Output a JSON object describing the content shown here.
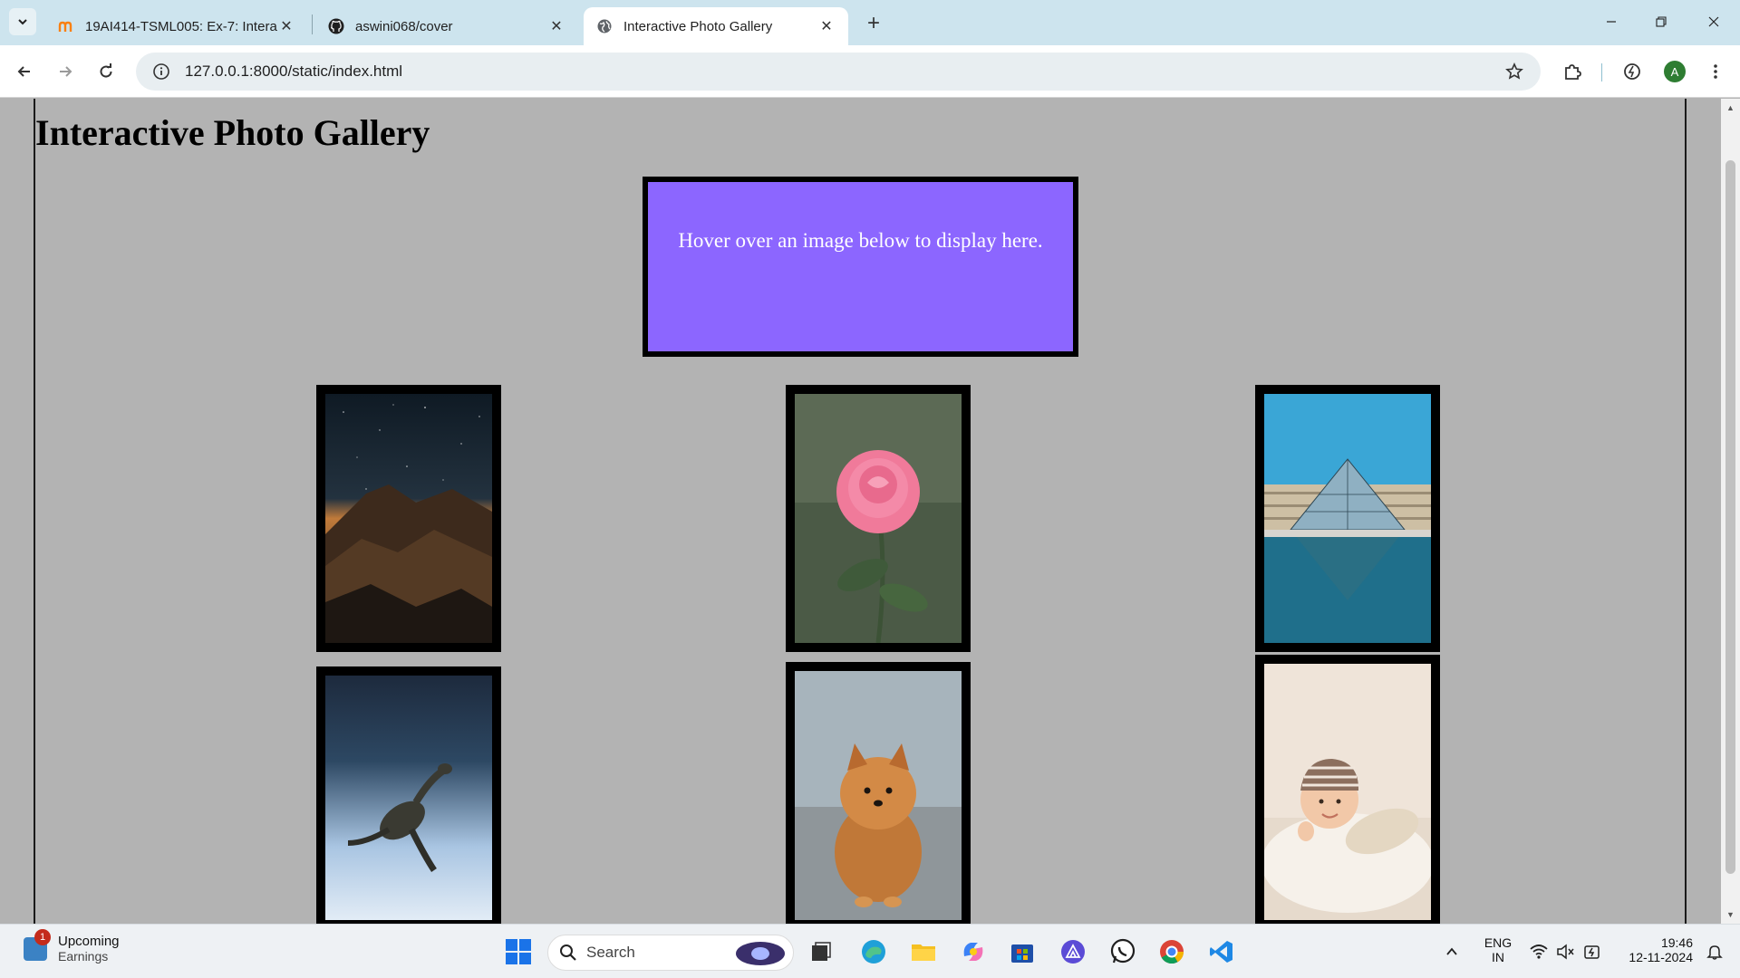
{
  "browser": {
    "tabs": [
      {
        "title": "19AI414-TSML005: Ex-7: Interac",
        "favicon": "moodle-icon"
      },
      {
        "title": "aswini068/cover",
        "favicon": "github-icon"
      },
      {
        "title": "Interactive Photo Gallery",
        "favicon": "globe-icon"
      }
    ],
    "url": "127.0.0.1:8000/static/index.html",
    "profile_initial": "A"
  },
  "page": {
    "title": "Interactive Photo Gallery",
    "display_text": "Hover over an image below to display here.",
    "display_bg": "#8c66ff",
    "photos": [
      {
        "name": "mountain-night-sky"
      },
      {
        "name": "pink-rose"
      },
      {
        "name": "louvre-pyramid"
      },
      {
        "name": "sea-turtle"
      },
      {
        "name": "pomeranian-puppy"
      },
      {
        "name": "baby-in-knit-hat"
      }
    ]
  },
  "taskbar": {
    "weather_line1": "Upcoming",
    "weather_line2": "Earnings",
    "notification_count": "1",
    "search_placeholder": "Search",
    "lang_line1": "ENG",
    "lang_line2": "IN",
    "time": "19:46",
    "date": "12-11-2024"
  }
}
